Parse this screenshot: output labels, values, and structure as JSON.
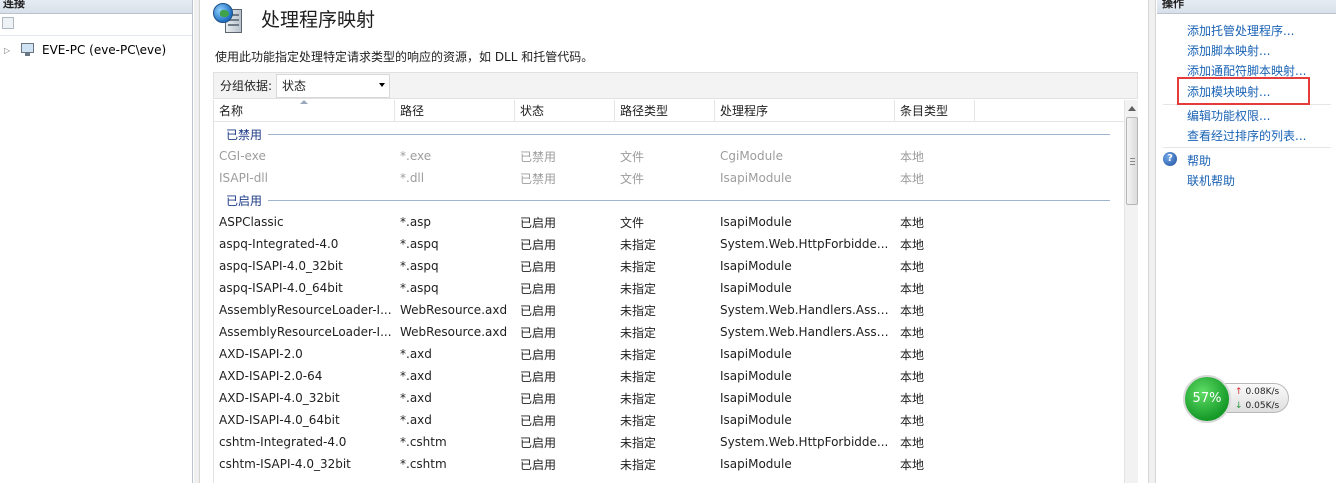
{
  "connections": {
    "header": "连接",
    "tree": [
      {
        "label": "EVE-PC (eve-PC\\eve)"
      }
    ]
  },
  "center": {
    "title": "处理程序映射",
    "description": "使用此功能指定处理特定请求类型的响应的资源，如 DLL 和托管代码。",
    "group_by_label": "分组依据:",
    "group_by_value": "状态",
    "columns": [
      "名称",
      "路径",
      "状态",
      "路径类型",
      "处理程序",
      "条目类型"
    ],
    "groups": [
      {
        "title": "已禁用",
        "rows": [
          [
            "CGI-exe",
            "*.exe",
            "已禁用",
            "文件",
            "CgiModule",
            "本地"
          ],
          [
            "ISAPI-dll",
            "*.dll",
            "已禁用",
            "文件",
            "IsapiModule",
            "本地"
          ]
        ]
      },
      {
        "title": "已启用",
        "rows": [
          [
            "ASPClassic",
            "*.asp",
            "已启用",
            "文件",
            "IsapiModule",
            "本地"
          ],
          [
            "aspq-Integrated-4.0",
            "*.aspq",
            "已启用",
            "未指定",
            "System.Web.HttpForbidde...",
            "本地"
          ],
          [
            "aspq-ISAPI-4.0_32bit",
            "*.aspq",
            "已启用",
            "未指定",
            "IsapiModule",
            "本地"
          ],
          [
            "aspq-ISAPI-4.0_64bit",
            "*.aspq",
            "已启用",
            "未指定",
            "IsapiModule",
            "本地"
          ],
          [
            "AssemblyResourceLoader-I...",
            "WebResource.axd",
            "已启用",
            "未指定",
            "System.Web.Handlers.Asse...",
            "本地"
          ],
          [
            "AssemblyResourceLoader-I...",
            "WebResource.axd",
            "已启用",
            "未指定",
            "System.Web.Handlers.Asse...",
            "本地"
          ],
          [
            "AXD-ISAPI-2.0",
            "*.axd",
            "已启用",
            "未指定",
            "IsapiModule",
            "本地"
          ],
          [
            "AXD-ISAPI-2.0-64",
            "*.axd",
            "已启用",
            "未指定",
            "IsapiModule",
            "本地"
          ],
          [
            "AXD-ISAPI-4.0_32bit",
            "*.axd",
            "已启用",
            "未指定",
            "IsapiModule",
            "本地"
          ],
          [
            "AXD-ISAPI-4.0_64bit",
            "*.axd",
            "已启用",
            "未指定",
            "IsapiModule",
            "本地"
          ],
          [
            "cshtm-Integrated-4.0",
            "*.cshtm",
            "已启用",
            "未指定",
            "System.Web.HttpForbidde...",
            "本地"
          ],
          [
            "cshtm-ISAPI-4.0_32bit",
            "*.cshtm",
            "已启用",
            "未指定",
            "IsapiModule",
            "本地"
          ]
        ]
      }
    ]
  },
  "actions": {
    "header": "操作",
    "items": [
      "添加托管处理程序...",
      "添加脚本映射...",
      "添加通配符脚本映射...",
      "添加模块映射...",
      "编辑功能权限...",
      "查看经过排序的列表...",
      "帮助",
      "联机帮助"
    ],
    "highlighted_item": "添加模块映射...",
    "highlight_color": "#e53b3b",
    "link_color": "#1a63b5"
  },
  "network_widget": {
    "percent": "57%",
    "upload": "0.08K/s",
    "download": "0.05K/s"
  }
}
